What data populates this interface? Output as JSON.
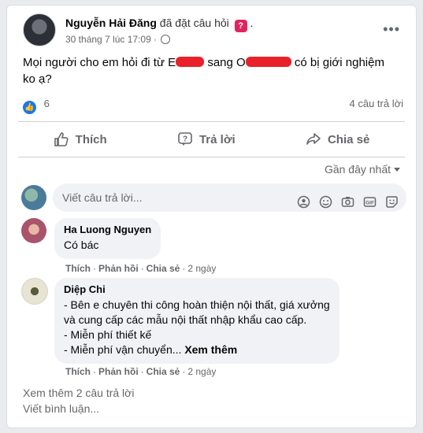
{
  "post": {
    "author": "Nguyễn Hải Đăng",
    "action": "đã đặt câu hỏi",
    "question_badge": "?",
    "timestamp": "30 tháng 7 lúc 17:09",
    "separator": "·",
    "text_part1": "Mọi người cho em hỏi đi từ E",
    "text_part2": "sang O",
    "text_part3": "có bị giới nghiệm ko ạ?",
    "reaction_count": "6",
    "answers_count": "4 câu trả lời"
  },
  "actions": {
    "like": "Thích",
    "reply": "Trả lời",
    "share": "Chia sẻ"
  },
  "sort_label": "Gần đây nhất",
  "composer_placeholder": "Viết câu trả lời...",
  "comments": [
    {
      "name": "Ha Luong Nguyen",
      "text": "Có bác",
      "like": "Thích",
      "reply": "Phản hồi",
      "share": "Chia sẻ",
      "time": "2 ngày"
    },
    {
      "name": "Diệp Chi",
      "text": "- Bên e chuyên thi công hoàn thiện nội thất, giá xưởng\nvà cung cấp các mẫu nội thất nhập khẩu cao cấp.\n- Miễn phí thiết kế\n- Miễn phí vận chuyển...",
      "see_more": "Xem thêm",
      "like": "Thích",
      "reply": "Phản hồi",
      "share": "Chia sẻ",
      "time": "2 ngày"
    }
  ],
  "more_replies": "Xem thêm 2 câu trả lời",
  "write_comment": "Viết bình luận...",
  "colors": {
    "like_blue": "#1877f2",
    "redaction": "#e8212b",
    "badge": "#e0245e"
  }
}
